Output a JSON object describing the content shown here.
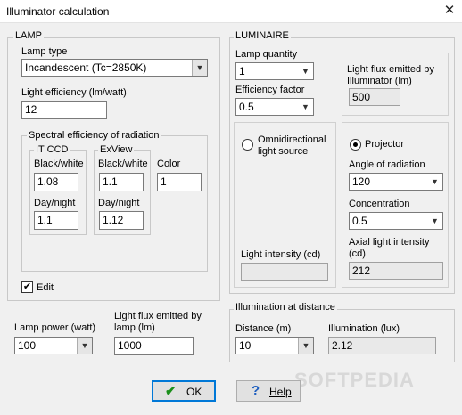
{
  "window": {
    "title": "Illuminator calculation",
    "close_glyph": "✕"
  },
  "lamp": {
    "group_title": "LAMP",
    "lamp_type_label": "Lamp type",
    "lamp_type_value": "Incandescent (Tc=2850K)",
    "light_efficiency_label": "Light efficiency (lm/watt)",
    "light_efficiency_value": "12",
    "spectral": {
      "group_title": "Spectral efficiency of radiation",
      "it_ccd": {
        "title": "IT CCD",
        "bw_label": "Black/white",
        "bw_value": "1.08",
        "dn_label": "Day/night",
        "dn_value": "1.1"
      },
      "exview": {
        "title": "ExView",
        "bw_label": "Black/white",
        "bw_value": "1.1",
        "dn_label": "Day/night",
        "dn_value": "1.12"
      },
      "color_label": "Color",
      "color_value": "1"
    },
    "edit_label": "Edit",
    "edit_checked": true
  },
  "lamp_power": {
    "label": "Lamp power (watt)",
    "value": "100"
  },
  "lamp_flux": {
    "label": "Light flux emitted by lamp (lm)",
    "value": "1000"
  },
  "luminaire": {
    "group_title": "LUMINAIRE",
    "lamp_quantity_label": "Lamp quantity",
    "lamp_quantity_value": "1",
    "efficiency_factor_label": "Efficiency factor",
    "efficiency_factor_value": "0.5",
    "flux_illuminator_label": "Light flux emitted by Illuminator (lm)",
    "flux_illuminator_value": "500",
    "omni_label": "Omnidirectional light source",
    "omni_selected": false,
    "light_intensity_label": "Light intensity (cd)",
    "light_intensity_value": "",
    "projector_label": "Projector",
    "projector_selected": true,
    "angle_label": "Angle of radiation",
    "angle_value": "120",
    "concentration_label": "Concentration",
    "concentration_value": "0.5",
    "axial_label": "Axial light intensity (cd)",
    "axial_value": "212"
  },
  "illumination": {
    "group_title": "Illumination at distance",
    "distance_label": "Distance (m)",
    "distance_value": "10",
    "illumination_label": "Illumination (lux)",
    "illumination_value": "2.12"
  },
  "buttons": {
    "ok_label": "OK",
    "help_label": "Help",
    "ok_icon": "✔",
    "help_icon": "?"
  },
  "watermark": "SOFTPEDIA",
  "colors": {
    "ok_check": "#1a8f1a",
    "help_icon": "#1f5fbf",
    "default_border": "#0078d7"
  },
  "icons": {
    "dropdown": "chevron-down-icon",
    "ok": "check-icon",
    "help": "question-icon",
    "close": "close-icon"
  }
}
